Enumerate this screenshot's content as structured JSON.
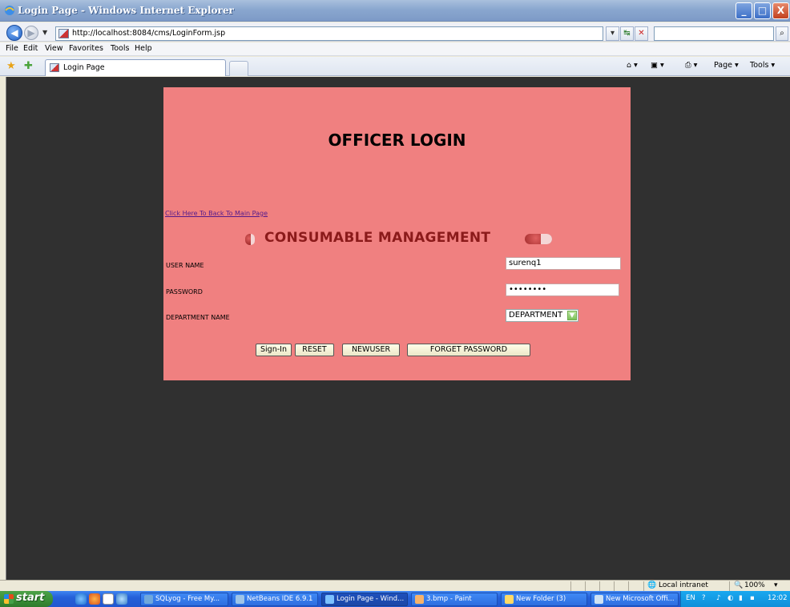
{
  "window": {
    "title": "Login Page - Windows Internet Explorer",
    "minimize": "_",
    "maximize": "□",
    "close": "X"
  },
  "address_bar": {
    "url": "http://localhost:8084/cms/LoginForm.jsp",
    "go_symbol": "↕",
    "refresh_symbol": "↹",
    "stop_symbol": "✕",
    "search_value": "",
    "search_symbol": "⌕"
  },
  "menu": {
    "items": [
      "File",
      "Edit",
      "View",
      "Favorites",
      "Tools",
      "Help"
    ]
  },
  "tabs": {
    "active_label": "Login Page"
  },
  "command_bar": {
    "page_label": "Page ▾",
    "tools_label": "Tools ▾"
  },
  "page": {
    "heading": "OFFICER LOGIN",
    "back_link": "Click Here To Back To Main Page",
    "banner": "CONSUMABLE MANAGEMENT",
    "username_label": "USER NAME",
    "username_value": "surenq1",
    "password_label": "PASSWORD",
    "password_value": "••••••••",
    "department_label": "DEPARTMENT NAME",
    "department_value": "DEPARTMENT",
    "buttons": {
      "signin": "Sign-In",
      "reset": "RESET",
      "newuser": "NEWUSER",
      "forget": "FORGET PASSWORD"
    },
    "colors": {
      "panel": "#f08080",
      "background": "#303030",
      "banner_text": "#8b1a1a"
    }
  },
  "status_bar": {
    "zone": "Local intranet",
    "zoom": "100%"
  },
  "taskbar": {
    "start": "start",
    "tasks": [
      "SQLyog - Free My...",
      "NetBeans IDE 6.9.1",
      "Login Page - Wind...",
      "3.bmp - Paint",
      "New Folder (3)",
      "New Microsoft Offi..."
    ],
    "lang": "EN",
    "clock": "12:02"
  }
}
